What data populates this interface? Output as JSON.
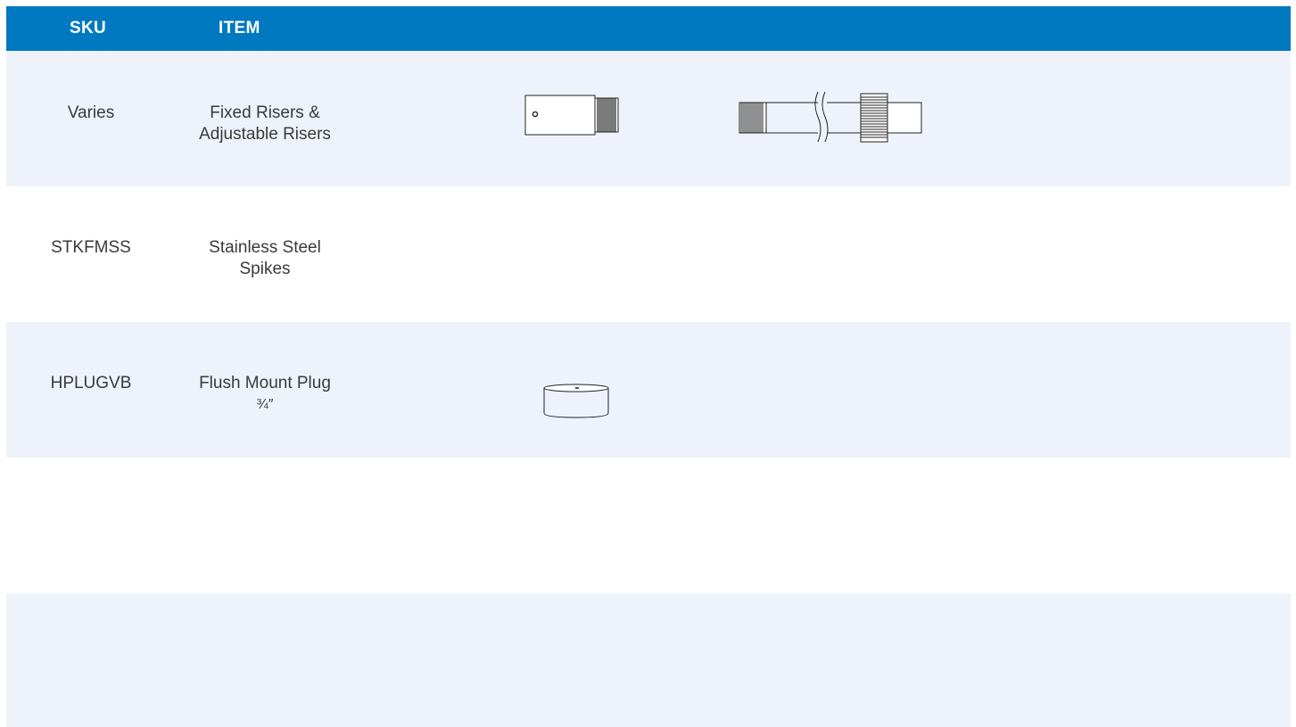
{
  "table": {
    "headers": {
      "sku": "SKU",
      "item": "ITEM"
    },
    "rows": [
      {
        "sku": "Varies",
        "item_lines": [
          "Fixed Risers &",
          "Adjustable Risers"
        ],
        "images": [
          "fixed-riser-drawing",
          "adjustable-riser-drawing"
        ]
      },
      {
        "sku": "STKFMSS",
        "item_lines": [
          "Stainless Steel",
          "Spikes"
        ],
        "images": []
      },
      {
        "sku": "HPLUGVB",
        "item_lines": [
          "Flush Mount Plug",
          "¾″"
        ],
        "images": [
          "flush-mount-plug-drawing"
        ]
      },
      {
        "sku": "",
        "item_lines": [],
        "images": []
      },
      {
        "sku": "",
        "item_lines": [],
        "images": []
      }
    ]
  },
  "colors": {
    "header": "#0079c1",
    "row_shaded": "#eef3fb",
    "row_plain": "#ffffff",
    "text": "#3a3a3a"
  }
}
